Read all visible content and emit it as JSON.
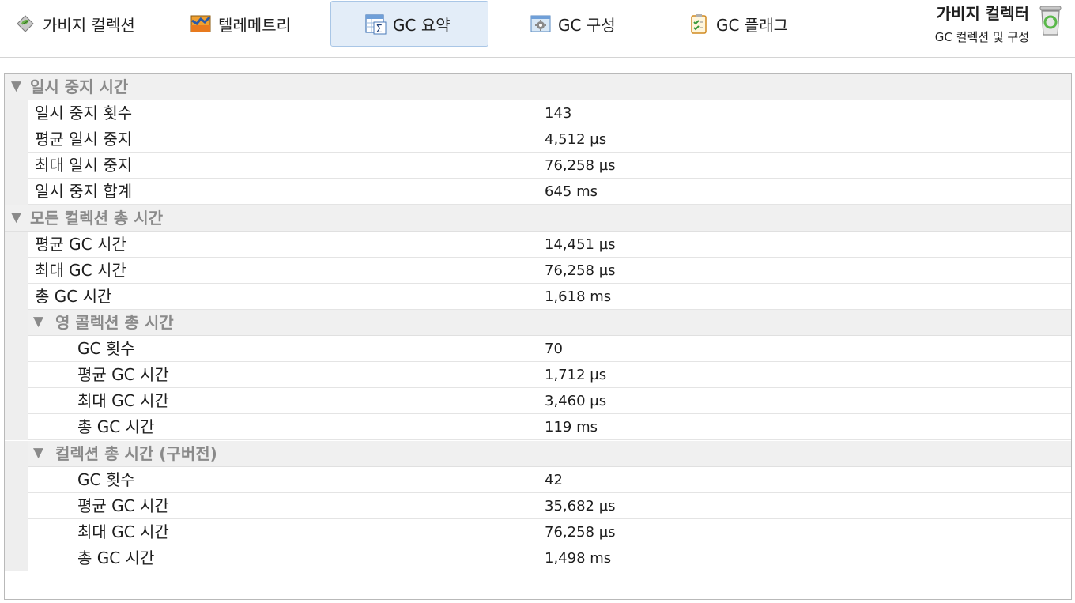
{
  "toolbar": {
    "tabs": [
      {
        "label": "가비지 컬렉션",
        "icon": "garbage-collection-icon"
      },
      {
        "label": "텔레메트리",
        "icon": "telemetry-chart-icon"
      },
      {
        "label": "GC 요약",
        "icon": "summary-sigma-icon"
      },
      {
        "label": "GC 구성",
        "icon": "config-gear-icon"
      },
      {
        "label": "GC 플래그",
        "icon": "checklist-icon"
      }
    ],
    "active_tab": "GC 요약"
  },
  "header": {
    "title": "가비지 컬렉터",
    "subtitle": "GC 컬렉션 및 구성",
    "icon": "recycle-bin-icon"
  },
  "table": {
    "sections": [
      {
        "label": "일시 중지 시간",
        "rows": [
          {
            "name": "일시 중지 횟수",
            "value": "143"
          },
          {
            "name": "평균 일시 중지",
            "value": "4,512 µs"
          },
          {
            "name": "최대 일시 중지",
            "value": "76,258 µs"
          },
          {
            "name": "일시 중지 합계",
            "value": "645 ms"
          }
        ]
      },
      {
        "label": "모든 컬렉션 총 시간",
        "rows": [
          {
            "name": "평균 GC 시간",
            "value": "14,451 µs"
          },
          {
            "name": "최대 GC 시간",
            "value": "76,258 µs"
          },
          {
            "name": "총 GC 시간",
            "value": "1,618 ms"
          }
        ],
        "subsections": [
          {
            "label": "영 콜렉션 총 시간",
            "rows": [
              {
                "name": "GC 횟수",
                "value": "70"
              },
              {
                "name": "평균 GC 시간",
                "value": "1,712 µs"
              },
              {
                "name": "최대 GC 시간",
                "value": "3,460 µs"
              },
              {
                "name": "총 GC 시간",
                "value": "119 ms"
              }
            ]
          },
          {
            "label": "컬렉션 총 시간 (구버전)",
            "rows": [
              {
                "name": "GC 횟수",
                "value": "42"
              },
              {
                "name": "평균 GC 시간",
                "value": "35,682 µs"
              },
              {
                "name": "최대 GC 시간",
                "value": "76,258 µs"
              },
              {
                "name": "총 GC 시간",
                "value": "1,498 ms"
              }
            ]
          }
        ]
      }
    ]
  }
}
